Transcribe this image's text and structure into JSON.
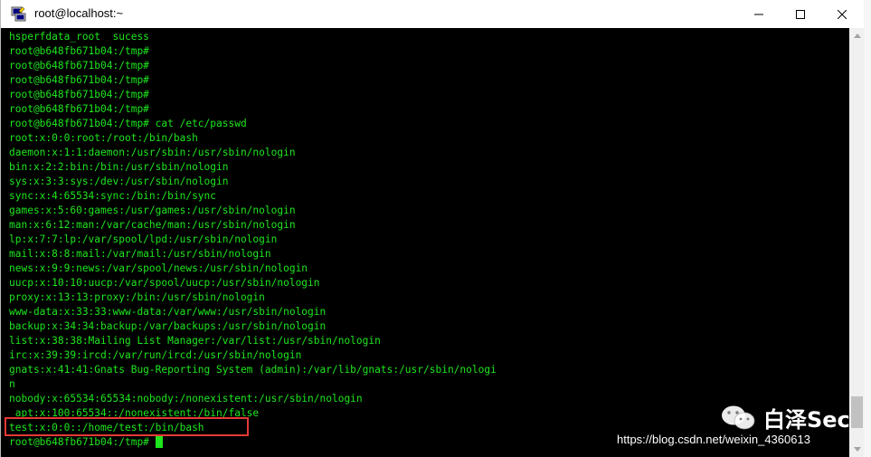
{
  "window": {
    "title": "root@localhost:~"
  },
  "terminal": {
    "lines": [
      "hsperfdata_root  sucess",
      "root@b648fb671b04:/tmp#",
      "root@b648fb671b04:/tmp#",
      "root@b648fb671b04:/tmp#",
      "root@b648fb671b04:/tmp#",
      "root@b648fb671b04:/tmp#",
      "root@b648fb671b04:/tmp# cat /etc/passwd",
      "root:x:0:0:root:/root:/bin/bash",
      "daemon:x:1:1:daemon:/usr/sbin:/usr/sbin/nologin",
      "bin:x:2:2:bin:/bin:/usr/sbin/nologin",
      "sys:x:3:3:sys:/dev:/usr/sbin/nologin",
      "sync:x:4:65534:sync:/bin:/bin/sync",
      "games:x:5:60:games:/usr/games:/usr/sbin/nologin",
      "man:x:6:12:man:/var/cache/man:/usr/sbin/nologin",
      "lp:x:7:7:lp:/var/spool/lpd:/usr/sbin/nologin",
      "mail:x:8:8:mail:/var/mail:/usr/sbin/nologin",
      "news:x:9:9:news:/var/spool/news:/usr/sbin/nologin",
      "uucp:x:10:10:uucp:/var/spool/uucp:/usr/sbin/nologin",
      "proxy:x:13:13:proxy:/bin:/usr/sbin/nologin",
      "www-data:x:33:33:www-data:/var/www:/usr/sbin/nologin",
      "backup:x:34:34:backup:/var/backups:/usr/sbin/nologin",
      "list:x:38:38:Mailing List Manager:/var/list:/usr/sbin/nologin",
      "irc:x:39:39:ircd:/var/run/ircd:/usr/sbin/nologin",
      "gnats:x:41:41:Gnats Bug-Reporting System (admin):/var/lib/gnats:/usr/sbin/nologi",
      "n",
      "nobody:x:65534:65534:nobody:/nonexistent:/usr/sbin/nologin",
      "_apt:x:100:65534::/nonexistent:/bin/false",
      "test:x:0:0::/home/test:/bin/bash"
    ],
    "prompt": "root@b648fb671b04:/tmp# ",
    "text_color": "#1ee61e",
    "background": "#000000",
    "highlight_color": "#e53935"
  },
  "watermark": {
    "brand": "白泽Sec",
    "url": "https://blog.csdn.net/weixin_4360613"
  },
  "icons": {
    "app": "putty-icon",
    "minimize": "minimize-icon",
    "maximize": "maximize-icon",
    "close": "close-icon"
  }
}
